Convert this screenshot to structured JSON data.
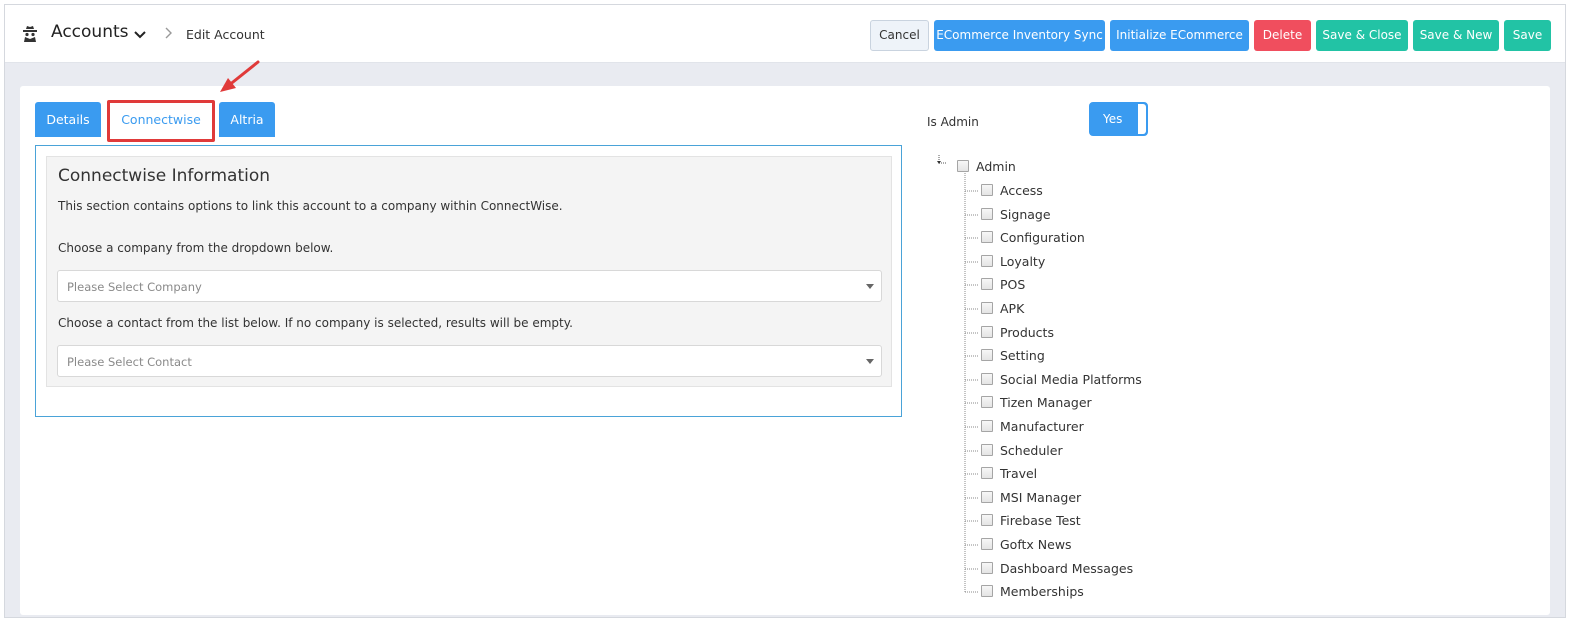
{
  "header": {
    "title": "Accounts",
    "breadcrumb_current": "Edit Account",
    "icons": {
      "page": "spy-icon",
      "title_dropdown": "chevron-down-icon",
      "separator": "chevron-right-icon"
    }
  },
  "toolbar": {
    "cancel": "Cancel",
    "ecommerce_sync": "ECommerce Inventory Sync",
    "initialize_ecommerce": "Initialize ECommerce",
    "delete": "Delete",
    "save_close": "Save & Close",
    "save_new": "Save & New",
    "save": "Save"
  },
  "tabs": [
    {
      "label": "Details"
    },
    {
      "label": "Connectwise",
      "active": true
    },
    {
      "label": "Altria"
    }
  ],
  "connectwise": {
    "title": "Connectwise Information",
    "description": "This section contains options to link this account to a company within ConnectWise.",
    "company_prompt": "Choose a company from the dropdown below.",
    "company_placeholder": "Please Select Company",
    "contact_prompt": "Choose a contact from the list below. If no company is selected, results will be empty.",
    "contact_placeholder": "Please Select Contact"
  },
  "permissions": {
    "is_admin_label": "Is Admin",
    "is_admin_value": "Yes",
    "root": "Admin",
    "children": [
      "Access",
      "Signage",
      "Configuration",
      "Loyalty",
      "POS",
      "APK",
      "Products",
      "Setting",
      "Social Media Platforms",
      "Tizen Manager",
      "Manufacturer",
      "Scheduler",
      "Travel",
      "MSI Manager",
      "Firebase Test",
      "Goftx News",
      "Dashboard Messages",
      "Memberships"
    ]
  },
  "colors": {
    "primary": "#3a9bf0",
    "success": "#22c3a5",
    "danger": "#f04e5e",
    "highlight": "#e03a3a"
  }
}
